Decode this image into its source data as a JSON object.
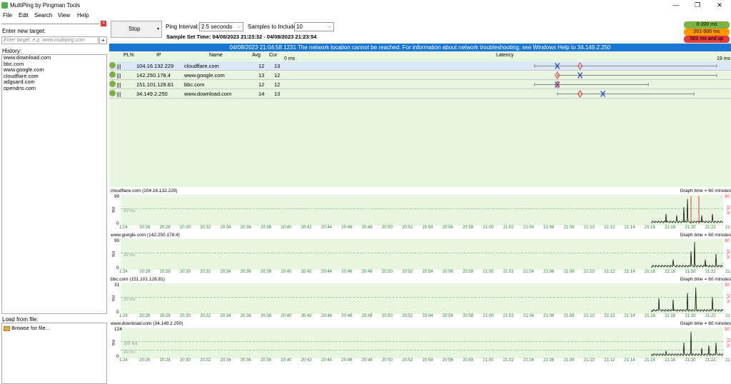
{
  "window": {
    "title": "MultiPing by Pingman Tools",
    "icon": "app-icon",
    "minimize_glyph": "—",
    "restore_glyph": "❐",
    "close_glyph": "✕"
  },
  "menu": [
    "File",
    "Edit",
    "Search",
    "View",
    "Help"
  ],
  "left": {
    "close_glyph": "×",
    "enter_label": "Enter new target:",
    "input_placeholder": "Enter target, e.g. www.multiping.com",
    "add_glyph": "+",
    "history_label": "History:",
    "history": [
      "www.download.com",
      "bbc.com",
      "www.google.com",
      "cloudflare.com",
      "adguard.com",
      "opendns.com"
    ],
    "load_label": "Load from file:",
    "browse_label": "Browse for file..."
  },
  "toolbar": {
    "stop_label": "Stop",
    "caret": "▾",
    "ping_interval_label": "Ping Interval:",
    "ping_interval_value": "2.5 seconds",
    "samples_label": "Samples to Include:",
    "samples_value": "10",
    "chevron": "⌵",
    "sample_set": "Sample Set Time: 04/08/2023 21:23:32 - 04/08/2023 21:23:54"
  },
  "legend": [
    {
      "label": "0-200 ms",
      "color": "#7cb342",
      "text": "#000"
    },
    {
      "label": "201-500 ms",
      "color": "#ff9800",
      "text": "#000"
    },
    {
      "label": "501 ms and up",
      "color": "#e53935",
      "text": "#000"
    }
  ],
  "banner": "04/08/2023 21:04:58 1231 The network location cannot be reached. For information about network troubleshooting, see Windows Help to 34.149.2.250",
  "table": {
    "headers": {
      "pl": "PL%",
      "ip": "IP",
      "name": "Name",
      "avg": "Avg",
      "cur": "Cur",
      "latency": "Latency",
      "lat_min": "0 ms",
      "lat_max": "19 ms"
    },
    "rows": [
      {
        "ip": "104.16.132.229",
        "name": "cloudflare.com",
        "avg": "12",
        "cur": "13",
        "min": 11,
        "avg_v": 12,
        "cur_v": 13,
        "max": 19
      },
      {
        "ip": "142.250.178.4",
        "name": "www.google.com",
        "avg": "13",
        "cur": "12",
        "min": 12,
        "avg_v": 13,
        "cur_v": 12,
        "max": 19
      },
      {
        "ip": "151.101.128.81",
        "name": "bbc.com",
        "avg": "12",
        "cur": "12",
        "min": 11,
        "avg_v": 12,
        "cur_v": 12,
        "max": 16
      },
      {
        "ip": "34.149.2.250",
        "name": "www.download.com",
        "avg": "14",
        "cur": "13",
        "min": 12,
        "avg_v": 14,
        "cur_v": 13,
        "max": 18
      }
    ]
  },
  "graphs": [
    {
      "title": "cloudflare.com (104.16.132.229)",
      "time": "Graph time = 60 minutes",
      "ymax": "90",
      "ymin": "0",
      "ms": "ms",
      "plmax": "30",
      "pl": "PL%",
      "ref": "50 ms"
    },
    {
      "title": "www.google.com (142.250.178.4)",
      "time": "Graph time = 60 minutes",
      "ymax": "90",
      "ymin": "0",
      "ms": "ms",
      "plmax": "30",
      "pl": "PL%",
      "ref": "50 ms"
    },
    {
      "title": "bbc.com (151.101.128.81)",
      "time": "Graph time = 60 minutes",
      "ymax": "31",
      "ymin": "0",
      "ms": "ms",
      "plmax": "30",
      "pl": "PL%",
      "ref": "20 ms"
    },
    {
      "title": "www.download.com (34.149.2.250)",
      "time": "Graph time = 60 minutes",
      "ymax": "124",
      "ymin": "0",
      "ms": "ms",
      "plmax": "30",
      "pl": "PL%",
      "ref": "100 ms",
      "ref2": "50 ms"
    }
  ],
  "ticks": [
    "1:24",
    "20:26",
    "20:28",
    "20:30",
    "20:32",
    "20:34",
    "20:36",
    "20:38",
    "20:40",
    "20:42",
    "20:44",
    "20:46",
    "20:48",
    "20:50",
    "20:52",
    "20:54",
    "20:56",
    "20:58",
    "21:00",
    "21:02",
    "21:04",
    "21:06",
    "21:08",
    "21:10",
    "21:12",
    "21:14",
    "21:16",
    "21:18",
    "21:20",
    "21:22",
    "21"
  ]
}
